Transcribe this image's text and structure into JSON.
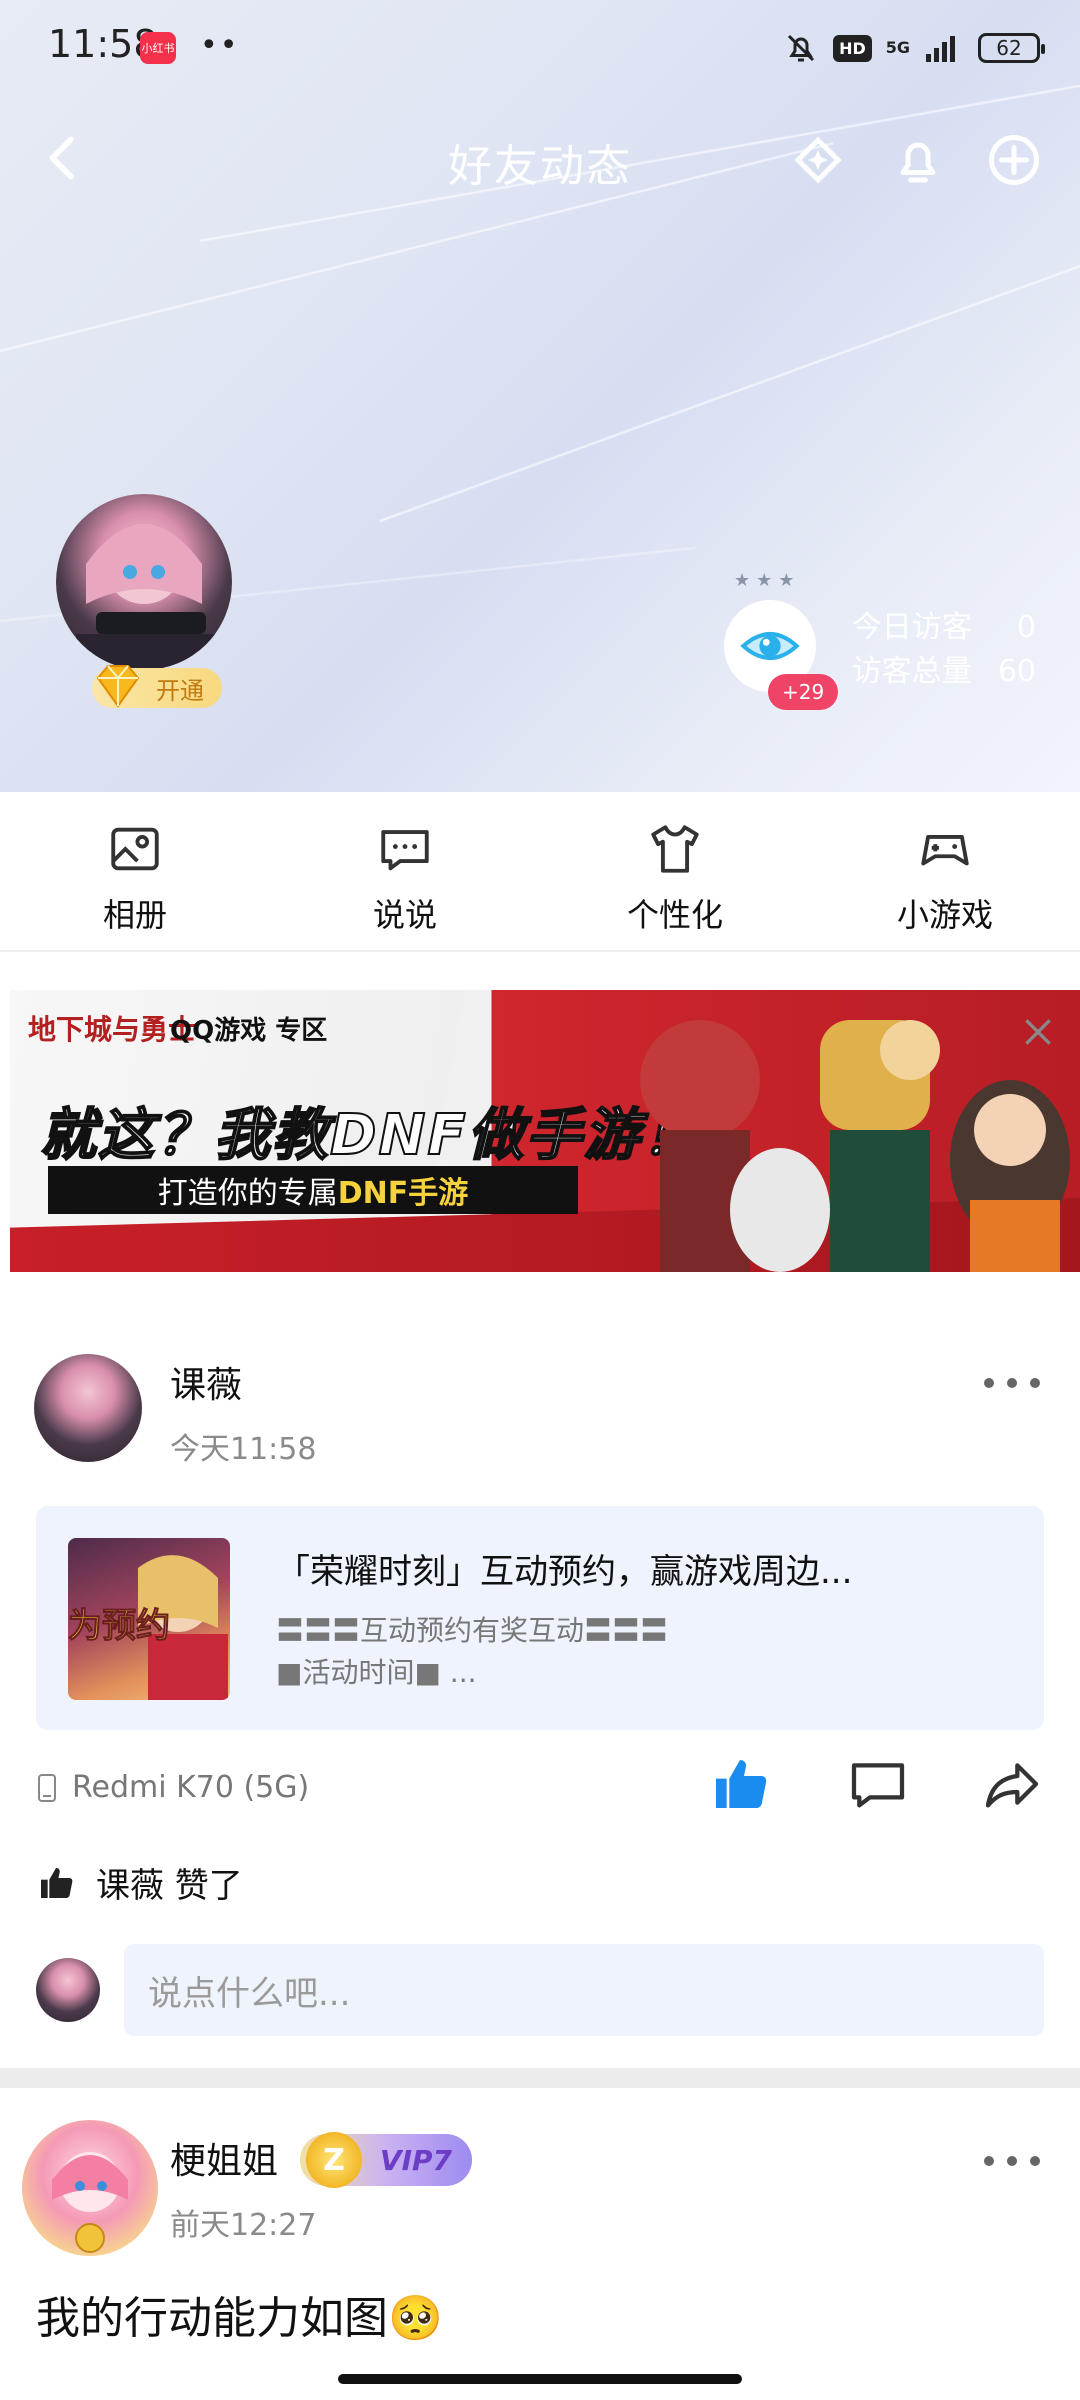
{
  "status_bar": {
    "time": "11:58",
    "app_badge": "小红书",
    "dots": "••",
    "hd": "HD",
    "network": "5G",
    "battery": "62"
  },
  "nav": {
    "title": "好友动态"
  },
  "profile": {
    "vip_open_label": "开通"
  },
  "visitors": {
    "badge": "+29",
    "today_label": "今日访客",
    "today_value": "0",
    "total_label": "访客总量",
    "total_value": "60"
  },
  "quick_tabs": [
    {
      "label": "相册",
      "icon": "photo-album-icon"
    },
    {
      "label": "说说",
      "icon": "speech-bubble-icon"
    },
    {
      "label": "个性化",
      "icon": "tshirt-icon"
    },
    {
      "label": "小游戏",
      "icon": "gamepad-icon"
    }
  ],
  "banner": {
    "logo": "地下城与勇士",
    "qq_game": "QQ游戏 专区",
    "headline": "就这？我教DNF做手游！",
    "sub_prefix": "打造你的专属",
    "sub_accent": "DNF手游"
  },
  "post1": {
    "author": "课薇",
    "time": "今天11:58",
    "share_title": "「荣耀时刻」互动预约，赢游戏周边...",
    "share_desc_line1": "〓〓〓互动预约有奖互动〓〓〓",
    "share_desc_line2": "■活动时间■ ...",
    "thumb_text": "为预约",
    "device": "Redmi K70 (5G)",
    "likes": "课薇 赞了",
    "comment_placeholder": "说点什么吧..."
  },
  "post2": {
    "author": "梗姐姐",
    "vip_label": "VIP7",
    "vip_z": "Z",
    "time": "前天12:27",
    "text": "我的行动能力如图🥺"
  },
  "colors": {
    "like_blue": "#1a8cf0",
    "badge_red": "#f04467",
    "comment_bg": "#eff3fb"
  }
}
